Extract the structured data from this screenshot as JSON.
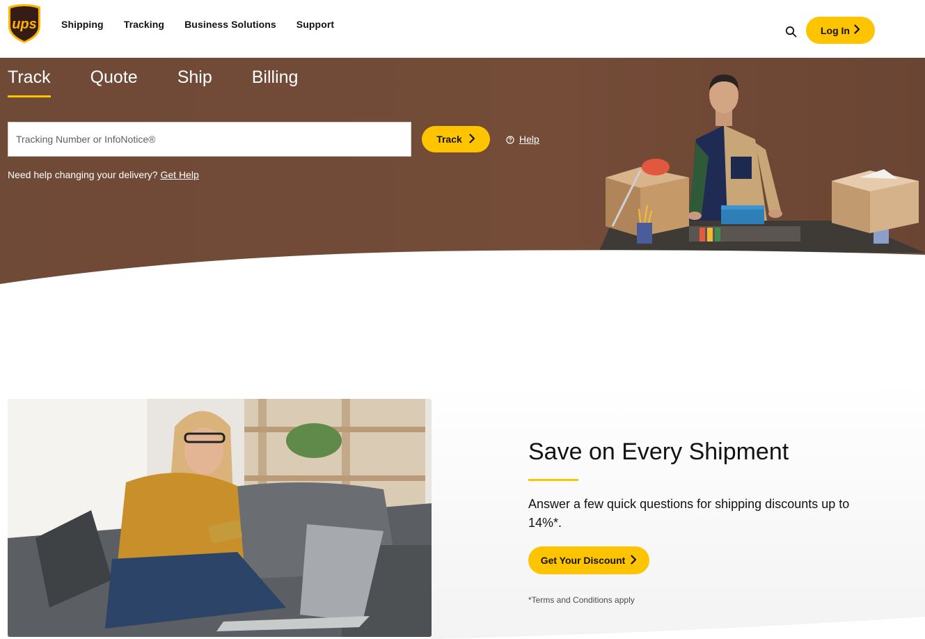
{
  "header": {
    "logo_text": "ups",
    "nav": [
      {
        "label": "Shipping"
      },
      {
        "label": "Tracking"
      },
      {
        "label": "Business Solutions"
      },
      {
        "label": "Support"
      }
    ],
    "login_label": "Log In"
  },
  "hero": {
    "tabs": [
      {
        "label": "Track",
        "active": true
      },
      {
        "label": "Quote",
        "active": false
      },
      {
        "label": "Ship",
        "active": false
      },
      {
        "label": "Billing",
        "active": false
      }
    ],
    "input_placeholder": "Tracking Number or InfoNotice®",
    "track_label": "Track",
    "help_label": "Help",
    "delivery_text": "Need help changing your delivery?",
    "delivery_link": "Get Help"
  },
  "promo": {
    "title": "Save on Every Shipment",
    "body": "Answer a few quick questions for shipping discounts up to 14%*.",
    "button_label": "Get Your Discount",
    "terms": "*Terms and Conditions apply"
  },
  "colors": {
    "accent": "#ffc400",
    "hero_brown": "#6f4a37",
    "ups_brown": "#351c15",
    "ups_gold": "#ffb500"
  },
  "icons": {
    "search": "search-icon",
    "chevron": "chevron-right-icon",
    "help": "question-circle-icon"
  }
}
